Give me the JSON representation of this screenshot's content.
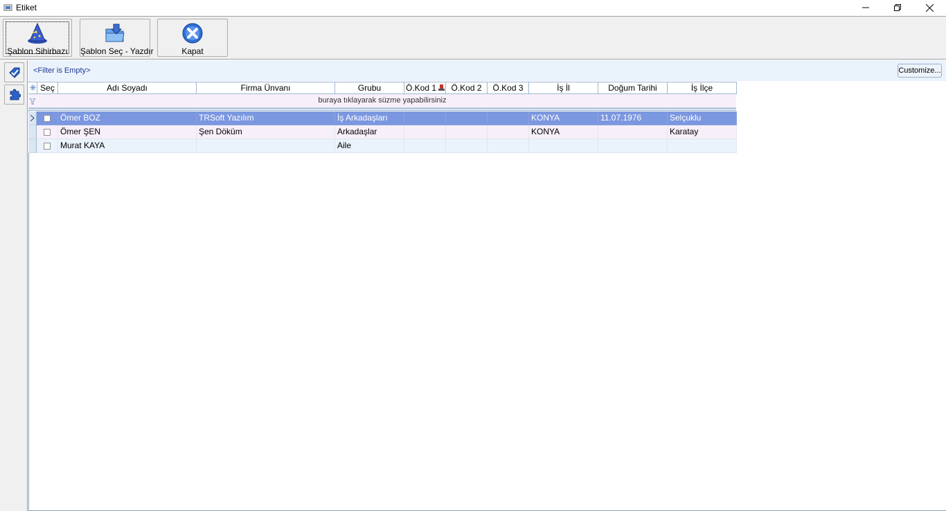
{
  "window": {
    "title": "Etiket",
    "controls": [
      "minimize",
      "restore",
      "close"
    ]
  },
  "toolbar": {
    "buttons": [
      {
        "label": "Şablon Sihirbazı",
        "icon": "wizard-hat-icon"
      },
      {
        "label": "Şablon Seç - Yazdır",
        "icon": "folder-print-icon"
      },
      {
        "label": "Kapat",
        "icon": "close-circle-icon"
      }
    ]
  },
  "sidebar": {
    "buttons": [
      {
        "icon": "check-tag-icon"
      },
      {
        "icon": "puzzle-icon"
      }
    ]
  },
  "filter": {
    "status": "<Filter is Empty>",
    "customize_label": "Customize...",
    "row_hint": "buraya tıklayarak süzme yapabilirsiniz"
  },
  "grid": {
    "columns": [
      "Seç",
      "Adı Soyadı",
      "Firma Ünvanı",
      "Grubu",
      "Ö.Kod 1",
      "Ö.Kod 2",
      "Ö.Kod 3",
      "İş İl",
      "Doğum Tarihi",
      "İş İlçe"
    ],
    "rows": [
      {
        "selected": true,
        "checked": false,
        "cells": [
          "Ömer BOZ",
          "TRSoft Yazılım",
          "İş Arkadaşları",
          "",
          "",
          "",
          "KONYA",
          "11.07.1976",
          "Selçuklu"
        ]
      },
      {
        "selected": false,
        "checked": false,
        "cells": [
          "Ömer ŞEN",
          "Şen Döküm",
          "Arkadaşlar",
          "",
          "",
          "",
          "KONYA",
          "",
          "Karatay"
        ]
      },
      {
        "selected": false,
        "checked": false,
        "cells": [
          "Murat KAYA",
          "",
          "Aile",
          "",
          "",
          "",
          "",
          "",
          ""
        ]
      }
    ]
  },
  "colors": {
    "selected_row": "#7b97e0",
    "row_even": "#eaf2fc",
    "row_odd": "#f7f0fa",
    "header_border": "#9fb6cf",
    "filter_text": "#1f3a93"
  }
}
